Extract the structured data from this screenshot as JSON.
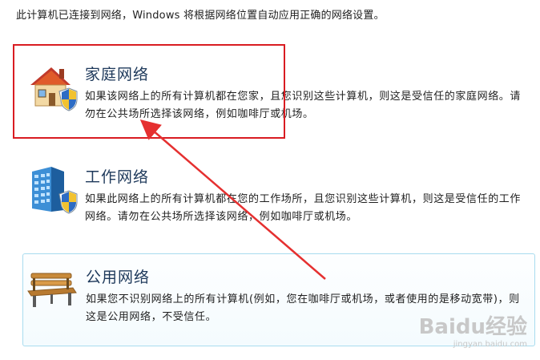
{
  "intro_text": "此计算机已连接到网络，Windows 将根据网络位置自动应用正确的网络设置。",
  "options": [
    {
      "title": "家庭网络",
      "description": "如果该网络上的所有计算机都在您家，且您识别这些计算机，则这是受信任的家庭网络。请勿在公共场所选择该网络，例如咖啡厅或机场。",
      "icon": "house-shield-icon"
    },
    {
      "title": "工作网络",
      "description": "如果此网络上的所有计算机都在您的工作场所，且您识别这些计算机，则这是受信任的工作网络。请勿在公共场所选择该网络，例如咖啡厅或机场。",
      "icon": "office-building-shield-icon"
    },
    {
      "title": "公用网络",
      "description": "如果您不识别网络上的所有计算机(例如，您在咖啡厅或机场，或者使用的是移动宽带)，则这是公用网络，不受信任。",
      "icon": "park-bench-icon"
    }
  ],
  "annotation_color": "#d91c22",
  "watermark": {
    "brand": "Baidu经验",
    "url": "jingyan.baidu.com"
  }
}
